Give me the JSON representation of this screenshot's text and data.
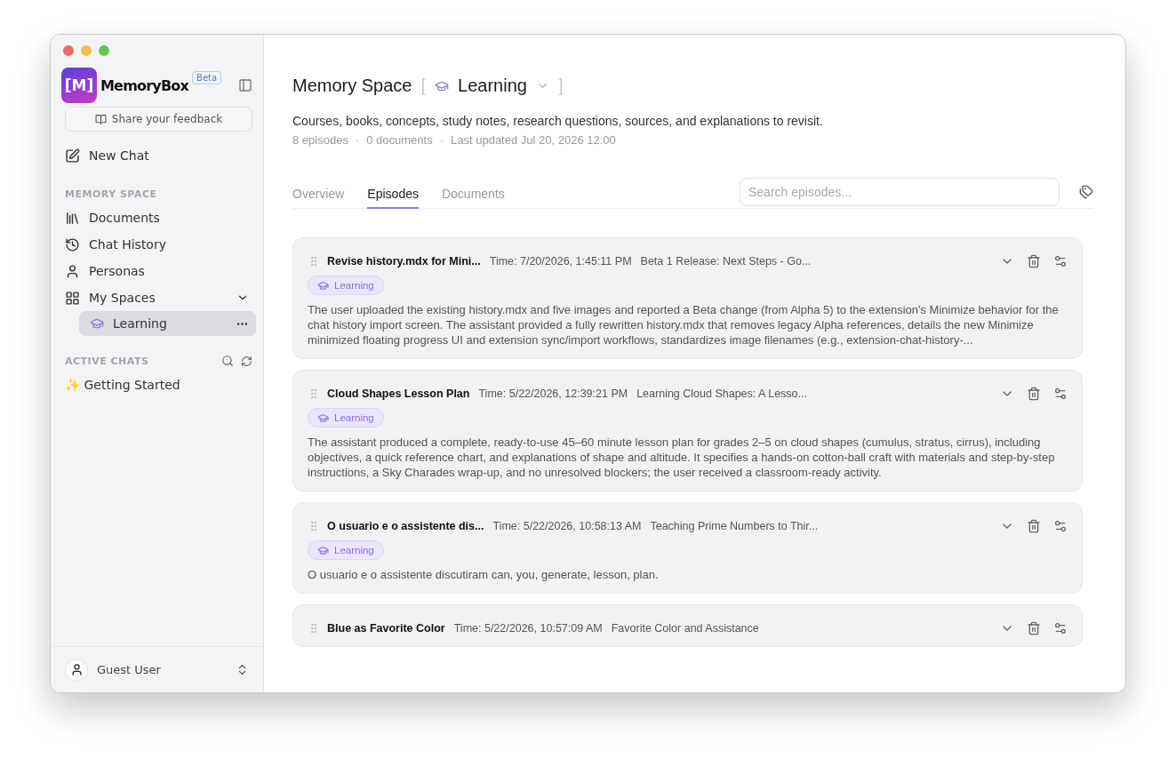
{
  "sidebar": {
    "logo": "[M]",
    "app_name": "MemoryBox",
    "badge": "Beta",
    "feedback_button": "Share your feedback",
    "new_chat": "New Chat",
    "memory_space": {
      "heading": "MEMORY SPACE",
      "items": [
        {
          "kind": "documents",
          "label": "Documents",
          "selected": false
        },
        {
          "kind": "history",
          "label": "Chat History",
          "selected": false
        },
        {
          "kind": "personas",
          "label": "Personas",
          "selected": false
        },
        {
          "kind": "spaces",
          "label": "My Spaces",
          "selected": false,
          "expanded": true,
          "children": [
            {
              "kind": "space",
              "label": "Learning",
              "selected": true
            }
          ]
        }
      ]
    },
    "active_chats": {
      "heading": "ACTIVE CHATS",
      "items": [
        {
          "label": "✨ Getting Started",
          "selected": false
        }
      ]
    },
    "user": {
      "name": "Guest User"
    }
  },
  "main": {
    "title": "Memory Space",
    "space": "Learning",
    "description": "Courses, books, concepts, study notes, research questions, sources, and explanations to revisit.",
    "brackets": [
      "[",
      "]"
    ],
    "meta_separators": [
      "·",
      "·"
    ],
    "meta": [
      "8 episodes",
      "0 documents",
      "Last updated Jul 20, 2026 12:00"
    ],
    "tabs": [
      {
        "label": "Overview",
        "selected": false
      },
      {
        "label": "Episodes",
        "selected": true
      },
      {
        "label": "Documents",
        "selected": false
      }
    ],
    "search": {
      "placeholder": "Search episodes..."
    },
    "episodes": [
      {
        "title": "Revise history.mdx for Mini...",
        "time": "Time: 7/20/2026, 1:45:11 PM",
        "chat": "Beta 1 Release: Next Steps - Go...",
        "tag": "Learning",
        "summary": "The user uploaded the existing history.mdx and five images and reported a Beta change (from Alpha 5) to the extension's Minimize behavior for the chat history import screen. The assistant provided a fully rewritten history.mdx that removes legacy Alpha references, details the new Minimize minimized floating progress UI and extension sync/import workflows, standardizes image filenames (e.g., extension-chat-history-..."
      },
      {
        "title": "Cloud Shapes Lesson Plan",
        "time": "Time: 5/22/2026, 12:39:21 PM",
        "chat": "Learning Cloud Shapes: A Lesso...",
        "tag": "Learning",
        "summary": "The assistant produced a complete, ready-to-use 45–60 minute lesson plan for grades 2–5 on cloud shapes (cumulus, stratus, cirrus), including objectives, a quick reference chart, and explanations of shape and altitude. It specifies a hands-on cotton-ball craft with materials and step-by-step instructions, a Sky Charades wrap-up, and no unresolved blockers; the user received a classroom-ready activity."
      },
      {
        "title": "O usuario e o assistente dis...",
        "time": "Time: 5/22/2026, 10:58:13 AM",
        "chat": "Teaching Prime Numbers to Thir...",
        "tag": "Learning",
        "summary": "O usuario e o assistente discutiram can, you, generate, lesson, plan."
      },
      {
        "title": "Blue as Favorite Color",
        "time": "Time: 5/22/2026, 10:57:09 AM",
        "chat": "Favorite Color and Assistance"
      }
    ]
  }
}
